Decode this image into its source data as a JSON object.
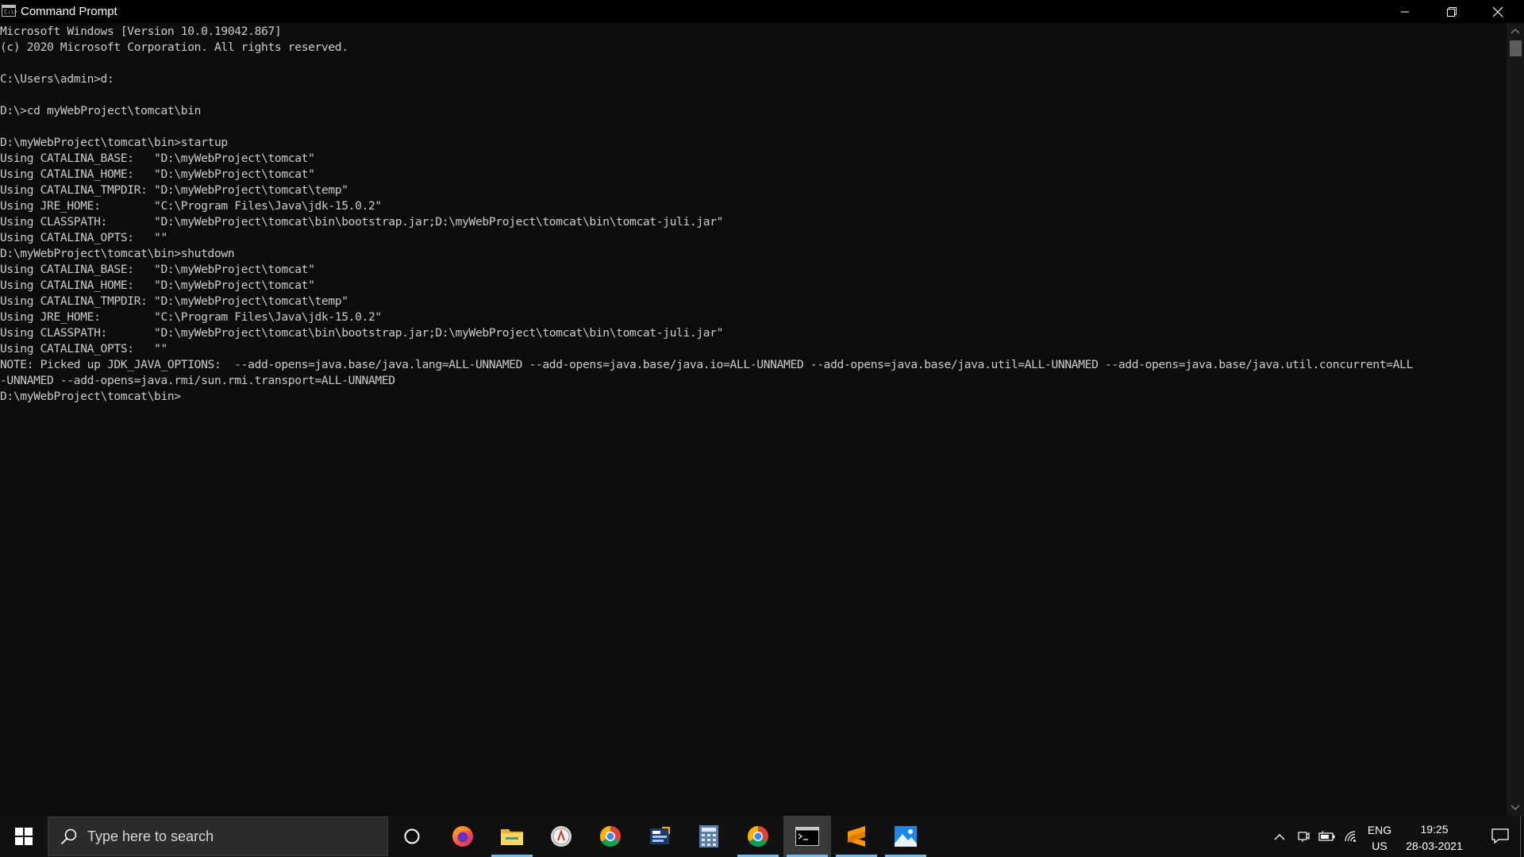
{
  "window": {
    "title": "Command Prompt",
    "icon_text": "C:\\>"
  },
  "console": {
    "lines": [
      "Microsoft Windows [Version 10.0.19042.867]",
      "(c) 2020 Microsoft Corporation. All rights reserved.",
      "",
      "C:\\Users\\admin>d:",
      "",
      "D:\\>cd myWebProject\\tomcat\\bin",
      "",
      "D:\\myWebProject\\tomcat\\bin>startup",
      "Using CATALINA_BASE:   \"D:\\myWebProject\\tomcat\"",
      "Using CATALINA_HOME:   \"D:\\myWebProject\\tomcat\"",
      "Using CATALINA_TMPDIR: \"D:\\myWebProject\\tomcat\\temp\"",
      "Using JRE_HOME:        \"C:\\Program Files\\Java\\jdk-15.0.2\"",
      "Using CLASSPATH:       \"D:\\myWebProject\\tomcat\\bin\\bootstrap.jar;D:\\myWebProject\\tomcat\\bin\\tomcat-juli.jar\"",
      "Using CATALINA_OPTS:   \"\"",
      "D:\\myWebProject\\tomcat\\bin>shutdown",
      "Using CATALINA_BASE:   \"D:\\myWebProject\\tomcat\"",
      "Using CATALINA_HOME:   \"D:\\myWebProject\\tomcat\"",
      "Using CATALINA_TMPDIR: \"D:\\myWebProject\\tomcat\\temp\"",
      "Using JRE_HOME:        \"C:\\Program Files\\Java\\jdk-15.0.2\"",
      "Using CLASSPATH:       \"D:\\myWebProject\\tomcat\\bin\\bootstrap.jar;D:\\myWebProject\\tomcat\\bin\\tomcat-juli.jar\"",
      "Using CATALINA_OPTS:   \"\"",
      "NOTE: Picked up JDK_JAVA_OPTIONS:  --add-opens=java.base/java.lang=ALL-UNNAMED --add-opens=java.base/java.io=ALL-UNNAMED --add-opens=java.base/java.util=ALL-UNNAMED --add-opens=java.base/java.util.concurrent=ALL",
      "-UNNAMED --add-opens=java.rmi/sun.rmi.transport=ALL-UNNAMED",
      "D:\\myWebProject\\tomcat\\bin>"
    ],
    "text_color": "#cccccc",
    "background": "#0c0c0c"
  },
  "taskbar": {
    "search_placeholder": "Type here to search",
    "apps": [
      {
        "name": "task-view-icon"
      },
      {
        "name": "firefox-icon"
      },
      {
        "name": "file-explorer-icon"
      },
      {
        "name": "app-circle-icon"
      },
      {
        "name": "chrome-icon"
      },
      {
        "name": "dev-tool-icon"
      },
      {
        "name": "calculator-icon"
      },
      {
        "name": "chrome-icon"
      },
      {
        "name": "command-prompt-icon"
      },
      {
        "name": "sublime-text-icon"
      },
      {
        "name": "photos-icon"
      }
    ],
    "language": {
      "line1": "ENG",
      "line2": "US"
    },
    "clock": {
      "time": "19:25",
      "date": "28-03-2021"
    },
    "accent": "#76b9ed"
  }
}
